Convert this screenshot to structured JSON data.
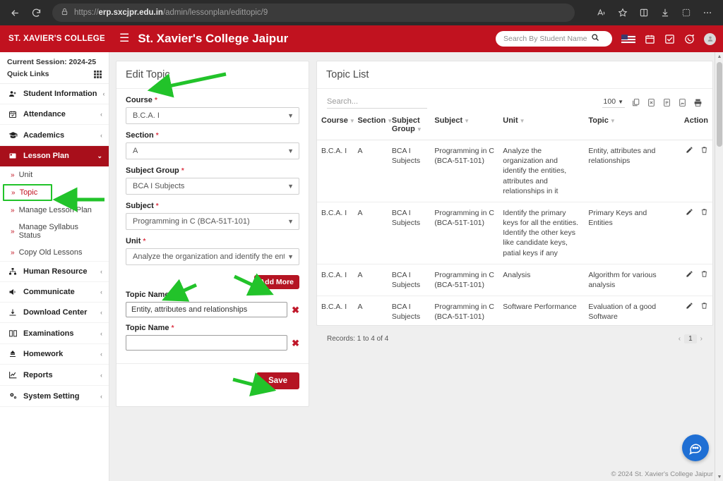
{
  "browser": {
    "url_prefix": "https://",
    "url_domain": "erp.sxcjpr.edu.in",
    "url_path": "/admin/lessonplan/edittopic/9",
    "back_icon": "back-arrow-icon",
    "reload_icon": "reload-icon",
    "lock_icon": "lock-icon",
    "read_aloud_icon": "read-aloud-icon",
    "favorite_icon": "star-icon",
    "split_screen_icon": "split-screen-icon",
    "downloads_icon": "download-icon",
    "extensions_icon": "extensions-icon",
    "settings_icon": "more-options-icon"
  },
  "header": {
    "brand": "ST. XAVIER'S COLLEGE",
    "menu_icon": "hamburger-icon",
    "title": "St. Xavier's College Jaipur",
    "search_placeholder": "Search By Student Name",
    "search_value": "",
    "search_icon": "search-icon",
    "language_icon": "flag-icon",
    "calendar_icon": "calendar-icon",
    "task_icon": "checkbox-icon",
    "whatsapp_icon": "whatsapp-icon",
    "avatar_icon": "user-avatar-icon"
  },
  "sidebar": {
    "session_label": "Current Session: 2024-25",
    "quick_links_label": "Quick Links",
    "quick_links_icon": "grid-icon",
    "items": [
      {
        "label": "Student Information",
        "icon": "user-plus-icon",
        "caret": "‹",
        "active": false
      },
      {
        "label": "Attendance",
        "icon": "calendar-check-icon",
        "caret": "‹",
        "active": false
      },
      {
        "label": "Academics",
        "icon": "graduation-cap-icon",
        "caret": "‹",
        "active": false
      },
      {
        "label": "Lesson Plan",
        "icon": "book-icon",
        "caret": "⌄",
        "active": true
      }
    ],
    "sub_items": [
      {
        "label": "Unit",
        "highlighted": false
      },
      {
        "label": "Topic",
        "highlighted": true
      },
      {
        "label": "Manage Lesson Plan",
        "highlighted": false
      },
      {
        "label": "Manage Syllabus Status",
        "highlighted": false
      },
      {
        "label": "Copy Old Lessons",
        "highlighted": false
      }
    ],
    "items_after": [
      {
        "label": "Human Resource",
        "icon": "sitemap-icon",
        "caret": "‹"
      },
      {
        "label": "Communicate",
        "icon": "megaphone-icon",
        "caret": "‹"
      },
      {
        "label": "Download Center",
        "icon": "download-icon",
        "caret": "‹"
      },
      {
        "label": "Examinations",
        "icon": "book-open-icon",
        "caret": "‹"
      },
      {
        "label": "Homework",
        "icon": "homework-icon",
        "caret": "‹"
      },
      {
        "label": "Reports",
        "icon": "chart-line-icon",
        "caret": "‹"
      },
      {
        "label": "System Setting",
        "icon": "gear-icon",
        "caret": "‹"
      }
    ]
  },
  "form": {
    "title": "Edit Topic",
    "fields": [
      {
        "label": "Course",
        "required": "*",
        "value": "B.C.A. I"
      },
      {
        "label": "Section",
        "required": "*",
        "value": "A"
      },
      {
        "label": "Subject Group",
        "required": "*",
        "value": "BCA I Subjects"
      },
      {
        "label": "Subject",
        "required": "*",
        "value": "Programming in C (BCA-51T-101)"
      },
      {
        "label": "Unit",
        "required": "*",
        "value": "Analyze the organization and identify the entities"
      }
    ],
    "add_more_label": "Add More",
    "topic_rows": [
      {
        "label": "Topic Name",
        "required": "*",
        "value": "Entity, attributes and relationships",
        "placeholder": "",
        "delete_icon": "delete-x-icon"
      },
      {
        "label": "Topic Name",
        "required": "*",
        "value": "",
        "placeholder": "",
        "delete_icon": "delete-x-icon"
      }
    ],
    "save_label": "Save"
  },
  "list": {
    "title": "Topic List",
    "search_placeholder": "Search...",
    "search_value": "",
    "page_size": "100",
    "export_icons": [
      "copy-icon",
      "excel-icon",
      "csv-icon",
      "pdf-icon",
      "print-icon"
    ],
    "columns": [
      "Course",
      "Section",
      "Subject Group",
      "Subject",
      "Unit",
      "Topic",
      "Action"
    ],
    "rows": [
      {
        "course": "B.C.A. I",
        "section": "A",
        "subject_group": "BCA I Subjects",
        "subject": "Programming in C (BCA-51T-101)",
        "unit": "Analyze the organization and identify the entities, attributes and relationships in it",
        "topic": "Entity, attributes and relationships",
        "edit_icon": "edit-pencil-icon",
        "delete_icon": "trash-icon"
      },
      {
        "course": "B.C.A. I",
        "section": "A",
        "subject_group": "BCA I Subjects",
        "subject": "Programming in C (BCA-51T-101)",
        "unit": "Identify the primary keys for all the entities. Identify the other keys like candidate keys, patial keys if any",
        "topic": "Primary Keys and Entities",
        "edit_icon": "edit-pencil-icon",
        "delete_icon": "trash-icon"
      },
      {
        "course": "B.C.A. I",
        "section": "A",
        "subject_group": "BCA I Subjects",
        "subject": "Programming in C (BCA-51T-101)",
        "unit": "Analysis",
        "topic": "Algorithm for various analysis",
        "edit_icon": "edit-pencil-icon",
        "delete_icon": "trash-icon"
      },
      {
        "course": "B.C.A. I",
        "section": "A",
        "subject_group": "BCA I Subjects",
        "subject": "Programming in C (BCA-51T-101)",
        "unit": "Software Performance",
        "topic": "Evaluation of a good Software",
        "edit_icon": "edit-pencil-icon",
        "delete_icon": "trash-icon"
      }
    ],
    "records_text": "Records: 1 to 4 of 4",
    "pager": {
      "prev": "‹",
      "page": "1",
      "next": "›"
    }
  },
  "footer": {
    "copyright": "© 2024 St. Xavier's College Jaipur"
  },
  "chat": {
    "icon": "chat-bubble-icon"
  },
  "colors": {
    "brand_red": "#c1121f",
    "dark_red": "#a80f1b",
    "button_red": "#b51423",
    "annotation_green": "#22c32a",
    "chat_blue": "#1f6fd4"
  }
}
